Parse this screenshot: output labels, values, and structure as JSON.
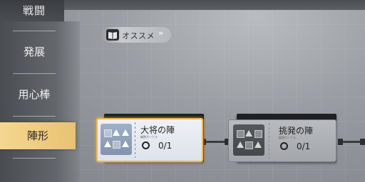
{
  "header": {
    "title": "戦闘"
  },
  "sidebar": {
    "items": [
      {
        "label": "発展"
      },
      {
        "label": "用心棒"
      },
      {
        "label": "陣形"
      }
    ]
  },
  "recommend": {
    "label": "オススメ",
    "chevron": "»",
    "icon": "book-icon"
  },
  "nodes": [
    {
      "title": "大将の陣",
      "subtitle": "編隊ボーナス",
      "count": "0/1",
      "state": "selected"
    },
    {
      "title": "挑発の陣",
      "subtitle": "編隊ボーナス",
      "count": "0/1",
      "state": "locked"
    }
  ],
  "colors": {
    "accent": "#f1b84a",
    "active_tab": "#f0cd83"
  }
}
